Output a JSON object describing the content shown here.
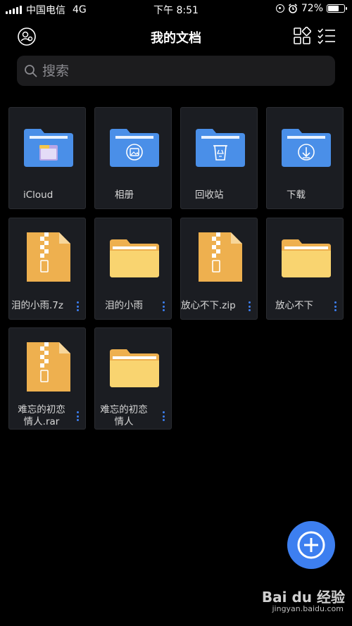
{
  "status_bar": {
    "carrier": "中国电信",
    "network": "4G",
    "time": "下午 8:51",
    "battery_percent": "72%",
    "battery_level": 0.72
  },
  "header": {
    "title": "我的文档"
  },
  "search": {
    "placeholder": "搜索"
  },
  "items": [
    {
      "name": "iCloud",
      "type": "system-folder",
      "icon": "cloud-folder-icon"
    },
    {
      "name": "相册",
      "type": "system-folder",
      "icon": "photo-folder-icon"
    },
    {
      "name": "回收站",
      "type": "system-folder",
      "icon": "recycle-folder-icon"
    },
    {
      "name": "下载",
      "type": "system-folder",
      "icon": "download-folder-icon"
    },
    {
      "name": "泪的小雨.7z",
      "type": "archive",
      "icon": "zip-file-icon"
    },
    {
      "name": "泪的小雨",
      "type": "folder",
      "icon": "folder-icon"
    },
    {
      "name": "放心不下.zip",
      "type": "archive",
      "icon": "zip-file-icon"
    },
    {
      "name": "放心不下",
      "type": "folder",
      "icon": "folder-icon"
    },
    {
      "name_line1": "难忘的初恋",
      "name_line2": "情人.rar",
      "type": "archive",
      "icon": "zip-file-icon"
    },
    {
      "name_line1": "难忘的初恋",
      "name_line2": "情人",
      "type": "folder",
      "icon": "folder-icon"
    }
  ],
  "colors": {
    "accent": "#3d7ff0",
    "system_folder": "#4a8fe8",
    "user_folder": "#f9d470",
    "archive": "#eeb04f"
  },
  "watermark": {
    "logo": "Bai du 经验",
    "url": "jingyan.baidu.com"
  }
}
